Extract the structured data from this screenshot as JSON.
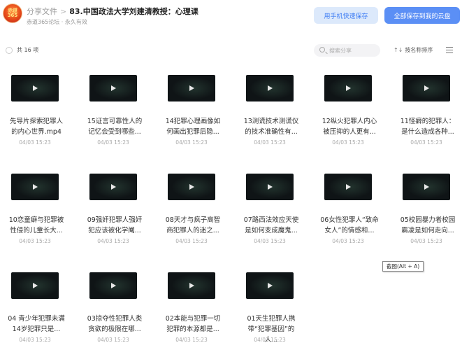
{
  "header": {
    "avatar_text": "赤道365论坛",
    "crumb_root": "分享文件",
    "crumb_sep": ">",
    "title": "83.中国政法大学刘建清教授：心理课",
    "sub": "赤道365论坛 · 永久有效",
    "phone_save_label": "用手机快速保存",
    "save_all_label": "全部保存到我的云盘"
  },
  "toolbar": {
    "count": "共 16 项",
    "search_placeholder": "搜索分享",
    "sort_label": "按名称排序",
    "sort_icon": "↑↓"
  },
  "tooltip": "截图(Alt + A)",
  "files": [
    {
      "name": "先导片探索犯罪人的内心世界.mp4",
      "date": "04/03 15:23"
    },
    {
      "name": "15证言可靠性人的记忆会受到哪些...",
      "date": "04/03 15:23"
    },
    {
      "name": "14犯罪心理画像如何画出犯罪后隐...",
      "date": "04/03 15:23"
    },
    {
      "name": "13测谎技术测谎仪的技术准确性有...",
      "date": "04/03 15:23"
    },
    {
      "name": "12纵火犯罪人内心被压抑的人更有...",
      "date": "04/03 15:23"
    },
    {
      "name": "11怪癖的犯罪人：是什么造成各种...",
      "date": "04/03 15:23"
    },
    {
      "name": "10恋童癖与犯罪被性侵的儿童长大...",
      "date": "04/03 15:23"
    },
    {
      "name": "09强奸犯罪人强奸犯应该被化学阉...",
      "date": "04/03 15:23"
    },
    {
      "name": "08天才与疯子高智商犯罪人的迷之...",
      "date": "04/03 15:23"
    },
    {
      "name": "07路西法效应天使是如何变成魔鬼...",
      "date": "04/03 15:23"
    },
    {
      "name": "06女性犯罪人“致命女人”的情感和...",
      "date": "04/03 15:23"
    },
    {
      "name": "05校园暴力者校园霸凌是如何走向...",
      "date": "04/03 15:23"
    },
    {
      "name": "04 青少年犯罪未满14岁犯罪只是...",
      "date": "04/03 15:23"
    },
    {
      "name": "03掠夺性犯罪人类贪欲的极限在哪...",
      "date": "04/03 15:23"
    },
    {
      "name": "02本能与犯罪一切犯罪的本源都是...",
      "date": "04/03 15:23"
    },
    {
      "name": "01天生犯罪人携带“犯罪基因”的人...",
      "date": "04/03 15:23"
    }
  ]
}
